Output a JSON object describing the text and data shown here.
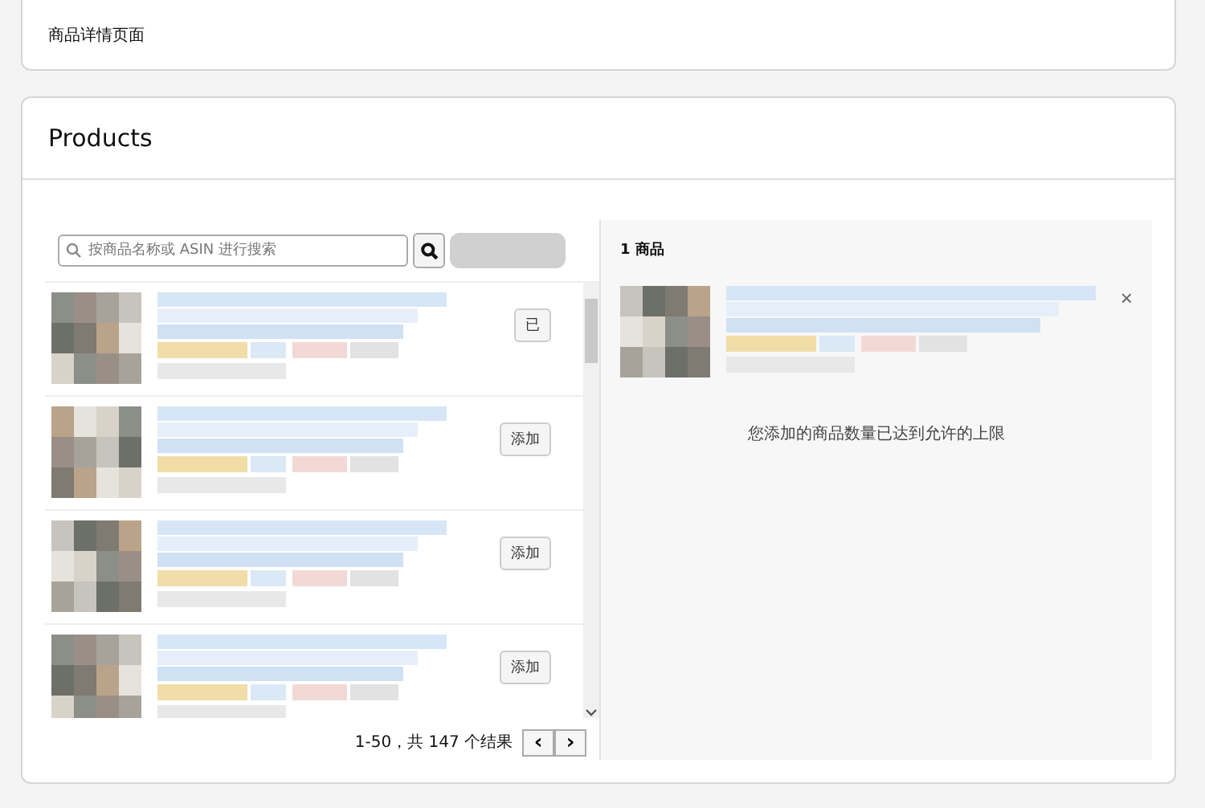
{
  "top_section": {
    "value": "商品详情页面"
  },
  "products": {
    "title": "Products",
    "search": {
      "placeholder": "按商品名称或 ASIN 进行搜索"
    },
    "results": [
      {
        "kind": "picture",
        "button": "已"
      },
      {
        "kind": "picture",
        "button": "添加"
      },
      {
        "kind": "picture",
        "button": "添加"
      },
      {
        "kind": "picture",
        "button": "添加"
      }
    ],
    "pagination": {
      "summary": "1-50，共 147 个结果",
      "prev": "‹",
      "next": "›"
    },
    "selected": {
      "count": "1 商品",
      "items": [
        {
          "kind": "picture",
          "remove": "×"
        }
      ],
      "message": "您添加的商品数量已达到允许的上限"
    }
  }
}
